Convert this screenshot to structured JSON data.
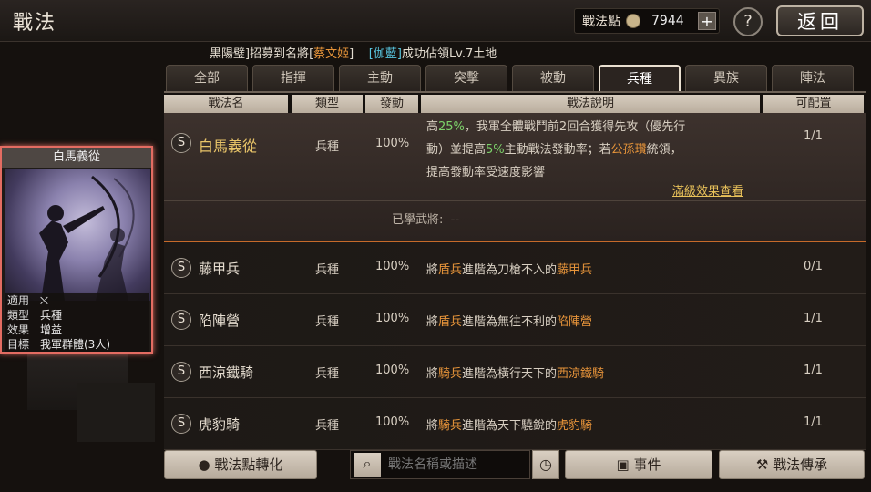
{
  "header": {
    "title": "戰法",
    "points_label": "戰法點",
    "points_value": "7944",
    "plus_label": "+",
    "help_label": "?",
    "back_label": "返回"
  },
  "ticker": {
    "p1": "黒陽璧]招募到名將[",
    "p2": "蔡文姬",
    "p3": "]",
    "p4": "[伽藍]",
    "p5": "成功佔領Lv.7土地"
  },
  "tabs": [
    "全部",
    "指揮",
    "主動",
    "突擊",
    "被動",
    "兵種",
    "異族",
    "陣法"
  ],
  "active_tab": "兵種",
  "table_headers": {
    "name": "戰法名",
    "type": "類型",
    "rate": "發動",
    "desc": "戰法說明",
    "config": "可配置"
  },
  "card": {
    "title": "白馬義從",
    "rows": [
      {
        "k": "適用",
        "v": "⛌"
      },
      {
        "k": "類型",
        "v": "兵種"
      },
      {
        "k": "效果",
        "v": "增益"
      },
      {
        "k": "目標",
        "v": "我軍群體(3人)"
      }
    ]
  },
  "expanded": {
    "badge": "S",
    "name": "白馬義從",
    "type": "兵種",
    "rate": "100%",
    "config": "1/1",
    "l1a": "高",
    "l1b": "25%",
    "l1c": "，我軍全體戰鬥前2回合獲得先攻（優先行",
    "l2a": "動）並提高",
    "l2b": "5%",
    "l2c": "主動戰法發動率；若",
    "l2d": "公孫瓚",
    "l2e": "統領，",
    "l3": "提高發動率受速度影響",
    "link": "滿級效果查看",
    "learned_label": "已學武將:",
    "learned_value": "--"
  },
  "rows": [
    {
      "badge": "S",
      "name": "藤甲兵",
      "type": "兵種",
      "rate": "100%",
      "d1": "將",
      "d2": "盾兵",
      "d3": "進階為刀槍不入的",
      "d4": "藤甲兵",
      "config": "0/1",
      "config_red": true
    },
    {
      "badge": "S",
      "name": "陷陣營",
      "type": "兵種",
      "rate": "100%",
      "d1": "將",
      "d2": "盾兵",
      "d3": "進階為無往不利的",
      "d4": "陷陣營",
      "config": "1/1"
    },
    {
      "badge": "S",
      "name": "西涼鐵騎",
      "type": "兵種",
      "rate": "100%",
      "d1": "將",
      "d2": "騎兵",
      "d3": "進階為橫行天下的",
      "d4": "西涼鐵騎",
      "config": "1/1"
    },
    {
      "badge": "S",
      "name": "虎豹騎",
      "type": "兵種",
      "rate": "100%",
      "d1": "將",
      "d2": "騎兵",
      "d3": "進階為天下驍銳的",
      "d4": "虎豹騎",
      "config": "1/1"
    }
  ],
  "bottom": {
    "convert": "戰法點轉化",
    "search_placeholder": "戰法名稱或描述",
    "events": "事件",
    "inherit": "戰法傳承"
  }
}
